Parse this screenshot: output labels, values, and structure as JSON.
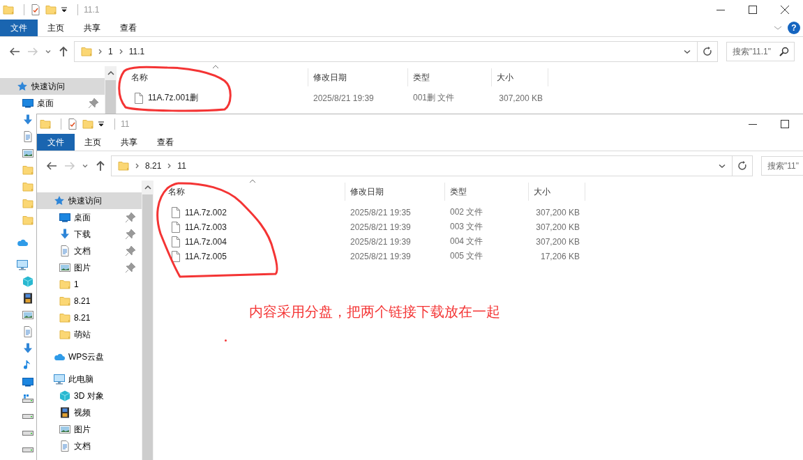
{
  "windows": [
    {
      "title": "11.1",
      "ribbon_tabs": [
        {
          "label": "文件",
          "selected": true
        },
        {
          "label": "主页",
          "selected": false
        },
        {
          "label": "共享",
          "selected": false
        },
        {
          "label": "查看",
          "selected": false
        }
      ],
      "help": "?",
      "path": [
        "1",
        "11.1"
      ],
      "search": {
        "placeholder": "搜索\"11.1\""
      },
      "sidebar": [
        {
          "label": "快速访问",
          "kind": "star",
          "selected": true,
          "children": [
            {
              "label": "桌面",
              "kind": "desktop",
              "pinned": true
            },
            {
              "kind": "download",
              "pinned": false
            },
            {
              "kind": "document",
              "pinned": false
            },
            {
              "kind": "picture",
              "pinned": false
            },
            {
              "kind": "folder",
              "pinned": false
            },
            {
              "kind": "folder",
              "pinned": false
            },
            {
              "kind": "folder",
              "pinned": false
            },
            {
              "kind": "folder",
              "pinned": false
            }
          ]
        },
        {
          "kind": "cloud",
          "selected": false
        },
        {
          "kind": "pc",
          "selected": false,
          "children": [
            {
              "kind": "cube"
            },
            {
              "kind": "video"
            },
            {
              "kind": "picture"
            },
            {
              "kind": "document"
            },
            {
              "kind": "download"
            },
            {
              "kind": "music"
            },
            {
              "kind": "desktop"
            },
            {
              "kind": "system-drive"
            },
            {
              "kind": "drive"
            },
            {
              "kind": "drive"
            },
            {
              "kind": "drive"
            }
          ]
        }
      ],
      "columns": [
        {
          "label": "名称",
          "sorted": true
        },
        {
          "label": "修改日期",
          "sorted": false
        },
        {
          "label": "类型",
          "sorted": false
        },
        {
          "label": "大小",
          "sorted": false
        }
      ],
      "files": [
        {
          "name": "11A.7z.001删",
          "modified": "2025/8/21 19:39",
          "type": "001删 文件",
          "size": "307,200 KB"
        }
      ]
    },
    {
      "title": "11",
      "ribbon_tabs": [
        {
          "label": "文件",
          "selected": true
        },
        {
          "label": "主页",
          "selected": false
        },
        {
          "label": "共享",
          "selected": false
        },
        {
          "label": "查看",
          "selected": false
        }
      ],
      "path": [
        "8.21",
        "11"
      ],
      "search": {
        "placeholder": "搜索\"11\""
      },
      "sidebar": [
        {
          "label": "快速访问",
          "kind": "star",
          "selected": true,
          "children": [
            {
              "label": "桌面",
              "kind": "desktop",
              "pinned": true
            },
            {
              "label": "下载",
              "kind": "download",
              "pinned": true
            },
            {
              "label": "文档",
              "kind": "document",
              "pinned": true
            },
            {
              "label": "图片",
              "kind": "picture",
              "pinned": true
            },
            {
              "label": "1",
              "kind": "folder",
              "pinned": false
            },
            {
              "label": "8.21",
              "kind": "folder",
              "pinned": false
            },
            {
              "label": "8.21",
              "kind": "folder",
              "pinned": false
            },
            {
              "label": "萌站",
              "kind": "folder",
              "pinned": false
            }
          ]
        },
        {
          "label": "WPS云盘",
          "kind": "cloud",
          "selected": false
        },
        {
          "label": "此电脑",
          "kind": "pc",
          "selected": false,
          "children": [
            {
              "label": "3D 对象",
              "kind": "cube"
            },
            {
              "label": "视频",
              "kind": "video"
            },
            {
              "label": "图片",
              "kind": "picture"
            },
            {
              "label": "文档",
              "kind": "document"
            }
          ]
        }
      ],
      "columns": [
        {
          "label": "名称",
          "sorted": true
        },
        {
          "label": "修改日期",
          "sorted": false
        },
        {
          "label": "类型",
          "sorted": false
        },
        {
          "label": "大小",
          "sorted": false
        }
      ],
      "files": [
        {
          "name": "11A.7z.002",
          "modified": "2025/8/21 19:35",
          "type": "002 文件",
          "size": "307,200 KB"
        },
        {
          "name": "11A.7z.003",
          "modified": "2025/8/21 19:39",
          "type": "003 文件",
          "size": "307,200 KB"
        },
        {
          "name": "11A.7z.004",
          "modified": "2025/8/21 19:39",
          "type": "004 文件",
          "size": "307,200 KB"
        },
        {
          "name": "11A.7z.005",
          "modified": "2025/8/21 19:39",
          "type": "005 文件",
          "size": "17,206 KB"
        }
      ]
    }
  ],
  "annotation": "内容采用分盘，把两个链接下载放在一起"
}
